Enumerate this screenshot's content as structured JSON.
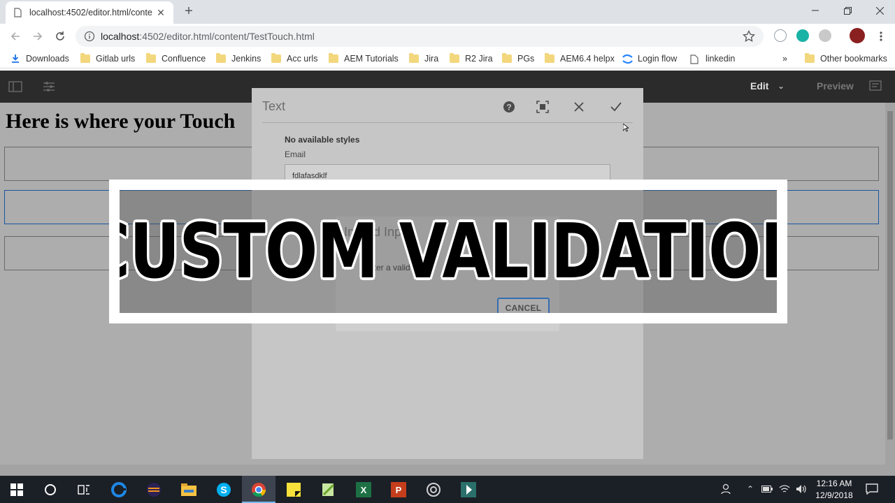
{
  "browser": {
    "tab": {
      "title": "localhost:4502/editor.html/conte"
    },
    "url": {
      "host": "localhost",
      "path": ":4502/editor.html/content/TestTouch.html"
    },
    "bookmarks": [
      "Downloads",
      "Gitlab urls",
      "Confluence",
      "Jenkins",
      "Acc urls",
      "AEM Tutorials",
      "Jira",
      "R2 Jira",
      "PGs",
      "AEM6.4 helpx",
      "Login flow",
      "linkedin"
    ],
    "bookmarks_overflow": "»",
    "other_bookmarks": "Other bookmarks"
  },
  "aem": {
    "edit_label": "Edit",
    "preview_label": "Preview",
    "page_heading": "Here is where your Touch"
  },
  "dialog": {
    "title": "Text",
    "no_styles": "No available styles",
    "field_label": "Email",
    "field_value": "fdlafasdklf"
  },
  "alert": {
    "title": "Invalid Input",
    "message": "Enter a valid email",
    "cancel_label": "CANCEL"
  },
  "banner": {
    "text": "CUSTOM VALIDATION"
  },
  "taskbar": {
    "time": "12:16 AM",
    "date": "12/9/2018"
  },
  "colors": {
    "accent": "#2680eb",
    "aem_bar": "#2b2b2b",
    "taskbar": "#1b1f26"
  }
}
